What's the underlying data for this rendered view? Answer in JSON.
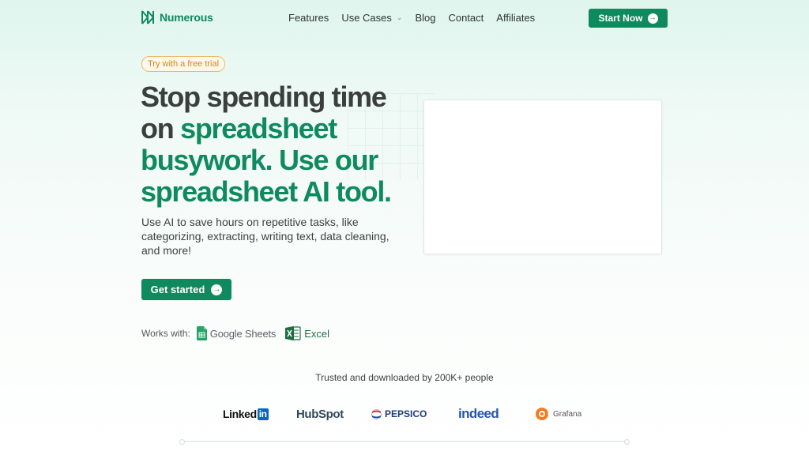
{
  "nav": {
    "logo_text": "Numerous",
    "links": [
      "Features",
      "Use Cases",
      "Blog",
      "Contact",
      "Affiliates"
    ],
    "cta_label": "Start Now"
  },
  "hero": {
    "badge": "Try with a free trial",
    "title_line1": "Stop spending time",
    "title_line2_plain": "on ",
    "title_line2_accent": "spreadsheet",
    "title_line3": "busywork. Use our",
    "title_line4": "spreadsheet AI tool.",
    "subtitle": "Use AI to save hours on repetitive tasks, like categorizing, extracting, writing text, data cleaning, and more!",
    "cta_label": "Get started"
  },
  "works_with": {
    "label": "Works with:",
    "apps": [
      "Google Sheets",
      "Excel"
    ]
  },
  "trusted": {
    "text": "Trusted and downloaded by 200K+ people",
    "brands": [
      "Linked",
      "in",
      "HubSpot",
      "PEPSICO",
      "indeed",
      "Grafana"
    ]
  },
  "colors": {
    "brand_green": "#0f8a5f",
    "badge_orange": "#d4861f"
  }
}
